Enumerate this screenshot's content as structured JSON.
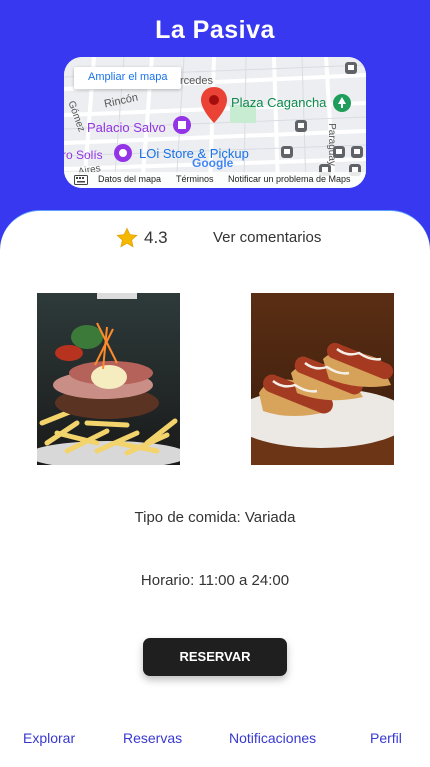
{
  "header": {
    "title": "La Pasiva"
  },
  "map": {
    "expand_label": "Ampliar el mapa",
    "places": {
      "plaza": "Plaza Cagancha",
      "palacio": "Palacio Salvo",
      "store": "LOi Store & Pickup",
      "solis": "ro Solís",
      "rincon": "Rincón",
      "gomez": "Gómez",
      "mercedes": "rcedes",
      "paraguay": "Paraguay",
      "aires": "Aires",
      "google": "Google"
    },
    "footer": {
      "data": "Datos del mapa",
      "terms": "Términos",
      "report": "Notificar un problema de Maps"
    }
  },
  "restaurant": {
    "rating": "4.3",
    "comments_link": "Ver comentarios",
    "food_type": "Tipo de comida: Variada",
    "hours": "Horario: 11:00 a 24:00",
    "reserve_label": "RESERVAR"
  },
  "nav": {
    "items": [
      {
        "label": "Explorar"
      },
      {
        "label": "Reservas"
      },
      {
        "label": "Notificaciones"
      },
      {
        "label": "Perfil"
      }
    ]
  },
  "colors": {
    "brand": "#3838f0",
    "button": "#1f1f1f",
    "star": "#f5b800",
    "nav_text": "#3838d0"
  }
}
